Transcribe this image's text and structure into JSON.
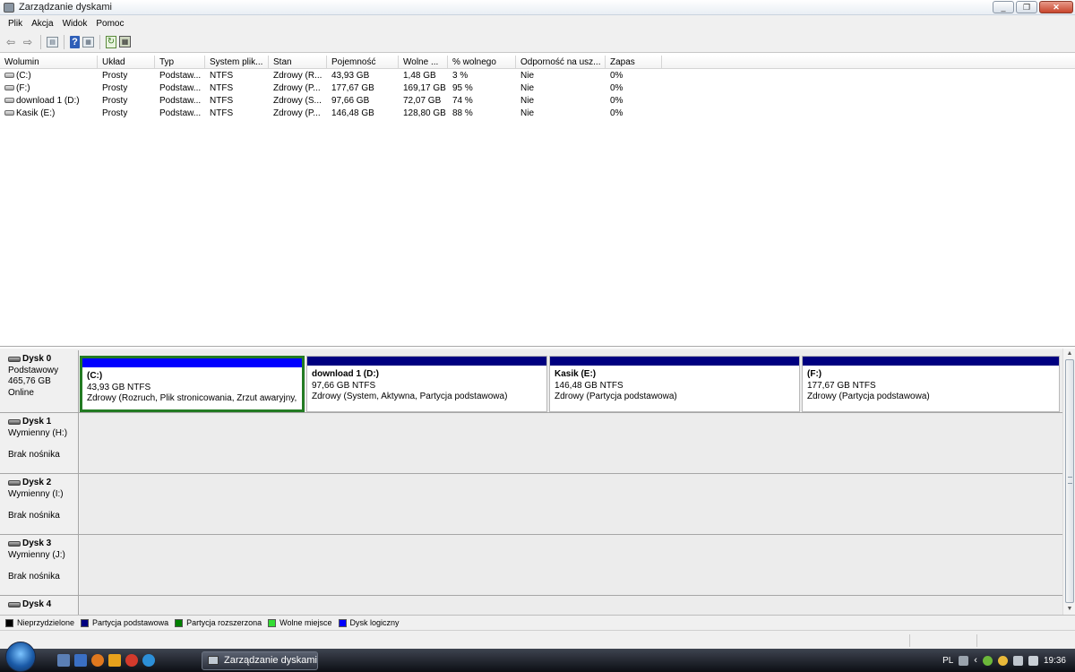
{
  "window": {
    "title": "Zarządzanie dyskami"
  },
  "menu": [
    "Plik",
    "Akcja",
    "Widok",
    "Pomoc"
  ],
  "toolbar": {
    "back": "⇦",
    "forward": "⇨",
    "help": "?"
  },
  "volumes": {
    "columns": [
      "Wolumin",
      "Układ",
      "Typ",
      "System plik...",
      "Stan",
      "Pojemność",
      "Wolne ...",
      "% wolnego",
      "Odporność na usz...",
      "Zapas"
    ],
    "rows": [
      [
        "(C:)",
        "Prosty",
        "Podstaw...",
        "NTFS",
        "Zdrowy (R...",
        "43,93 GB",
        "1,48 GB",
        "3 %",
        "Nie",
        "0%"
      ],
      [
        "(F:)",
        "Prosty",
        "Podstaw...",
        "NTFS",
        "Zdrowy (P...",
        "177,67 GB",
        "169,17 GB",
        "95 %",
        "Nie",
        "0%"
      ],
      [
        "download 1 (D:)",
        "Prosty",
        "Podstaw...",
        "NTFS",
        "Zdrowy (S...",
        "97,66 GB",
        "72,07 GB",
        "74 %",
        "Nie",
        "0%"
      ],
      [
        "Kasik  (E:)",
        "Prosty",
        "Podstaw...",
        "NTFS",
        "Zdrowy (P...",
        "146,48 GB",
        "128,80 GB",
        "88 %",
        "Nie",
        "0%"
      ]
    ]
  },
  "disks": [
    {
      "name": "Dysk 0",
      "kind": "Podstawowy",
      "size": "465,76 GB",
      "status": "Online",
      "partitions": [
        {
          "name": "(C:)",
          "size": "43,93 GB NTFS",
          "state": "Zdrowy (Rozruch, Plik stronicowania, Zrzut awaryjny,"
        },
        {
          "name": "download 1  (D:)",
          "size": "97,66 GB NTFS",
          "state": "Zdrowy (System, Aktywna, Partycja podstawowa)"
        },
        {
          "name": "Kasik   (E:)",
          "size": "146,48 GB NTFS",
          "state": "Zdrowy (Partycja podstawowa)"
        },
        {
          "name": "(F:)",
          "size": "177,67 GB NTFS",
          "state": "Zdrowy (Partycja podstawowa)"
        }
      ]
    },
    {
      "name": "Dysk 1",
      "kind": "Wymienny (H:)",
      "media": "Brak nośnika"
    },
    {
      "name": "Dysk 2",
      "kind": "Wymienny (I:)",
      "media": "Brak nośnika"
    },
    {
      "name": "Dysk 3",
      "kind": "Wymienny (J:)",
      "media": "Brak nośnika"
    },
    {
      "name": "Dysk 4"
    }
  ],
  "legend": [
    {
      "label": "Nieprzydzielone",
      "color": "#000000"
    },
    {
      "label": "Partycja podstawowa",
      "color": "#000080"
    },
    {
      "label": "Partycja rozszerzona",
      "color": "#008000"
    },
    {
      "label": "Wolne miejsce",
      "color": "#33dd33"
    },
    {
      "label": "Dysk logiczny",
      "color": "#0000ff"
    }
  ],
  "taskbar": {
    "task_label": "Zarządzanie dyskami",
    "lang": "PL",
    "clock": "19:36"
  }
}
